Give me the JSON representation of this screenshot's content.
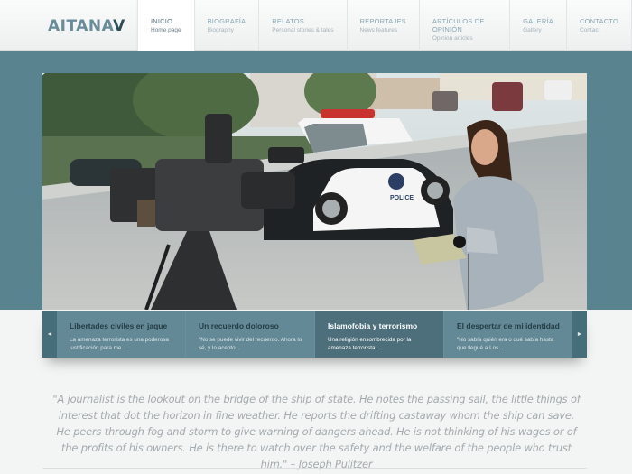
{
  "logo": {
    "text_main": "AITANA",
    "text_accent": "V"
  },
  "nav": [
    {
      "label": "INICIO",
      "sub": "Home page",
      "active": true
    },
    {
      "label": "BIOGRAFÍA",
      "sub": "Biography"
    },
    {
      "label": "RELATOS",
      "sub": "Personal stories & tales"
    },
    {
      "label": "REPORTAJES",
      "sub": "News features"
    },
    {
      "label": "ARTÍCULOS DE OPINIÓN",
      "sub": "Opinion articles"
    },
    {
      "label": "GALERÍA",
      "sub": "Gallery"
    },
    {
      "label": "CONTACTO",
      "sub": "Contact"
    }
  ],
  "hero": {
    "car_badge": "POLICE"
  },
  "slider": {
    "prev_icon": "◄",
    "next_icon": "►",
    "slides": [
      {
        "title": "Libertades civiles en jaque",
        "desc": "La amenaza terrorista es una poderosa justificación para me..."
      },
      {
        "title": "Un recuerdo doloroso",
        "desc": "\"No se puede vivir del recuerdo. Ahora lo sé, y lo acepto..."
      },
      {
        "title": "Islamofobia y terrorismo",
        "desc": "Una religión ensombrecida por la amenaza terrorista.",
        "active": true
      },
      {
        "title": "El despertar de mi identidad",
        "desc": "\"No sabía quién era o qué sabía hasta que llegué a Los..."
      }
    ]
  },
  "quote": "\"A journalist is the lookout on the bridge of the ship of state. He notes the passing sail, the little things of interest that dot the horizon in fine weather. He reports the drifting castaway whom the ship can save. He peers through fog and storm to give warning of dangers ahead. He is not thinking of his wages or of the profits of his owners. He is there to watch over the safety and the welfare of the people who trust him.\" – Joseph Pulitzer",
  "colors": {
    "band": "#59838f",
    "slider_active": "#4c6f7b",
    "logo_accent": "#2d4c58"
  }
}
